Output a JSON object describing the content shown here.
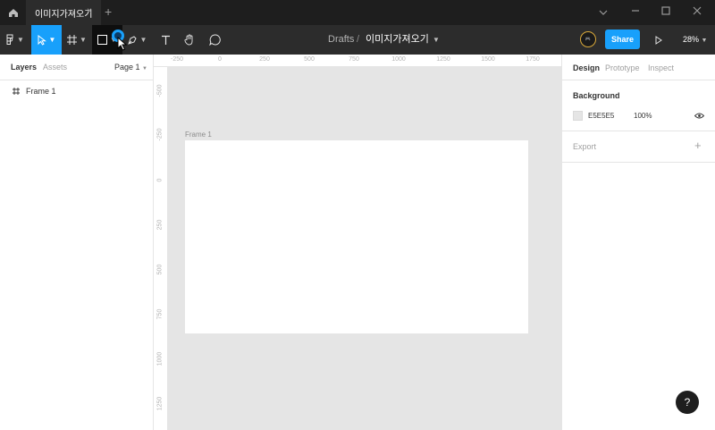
{
  "titlebar": {
    "tab_title": "이미지가져오기",
    "tab_close": "×",
    "new_tab": "+"
  },
  "toolbar": {
    "breadcrumb_drafts": "Drafts",
    "breadcrumb_sep": "/",
    "file_name": "이미지가져오기",
    "share_label": "Share",
    "zoom_label": "28%",
    "avatar_text": "🎮",
    "accent_color": "#18a0fb"
  },
  "left_panel": {
    "tab_layers": "Layers",
    "tab_assets": "Assets",
    "page_label": "Page 1",
    "layers": [
      {
        "name": "Frame 1"
      }
    ]
  },
  "right_panel": {
    "tab_design": "Design",
    "tab_prototype": "Prototype",
    "tab_inspect": "Inspect",
    "background_title": "Background",
    "background_hex": "E5E5E5",
    "background_opacity": "100%",
    "export_title": "Export",
    "export_add": "+"
  },
  "rulers": {
    "top": [
      "-250",
      "0",
      "250",
      "500",
      "750",
      "1000",
      "1250",
      "1500",
      "1750"
    ],
    "left": [
      "-500",
      "-250",
      "0",
      "250",
      "500",
      "750",
      "1000",
      "1250"
    ]
  },
  "canvas": {
    "frame_label": "Frame 1"
  },
  "help": {
    "label": "?"
  }
}
